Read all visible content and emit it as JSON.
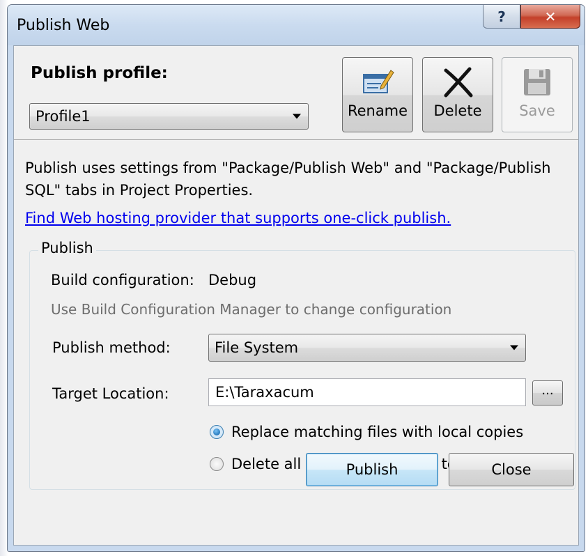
{
  "window": {
    "title": "Publish Web",
    "help_glyph": "?",
    "close_glyph": "✕"
  },
  "header": {
    "profile_label": "Publish profile:",
    "profile_value": "Profile1",
    "rename_label": "Rename",
    "delete_label": "Delete",
    "save_label": "Save",
    "save_enabled": false
  },
  "body": {
    "description": "Publish uses settings from \"Package/Publish Web\" and \"Package/Publish SQL\" tabs in Project Properties.",
    "provider_link": "Find Web hosting provider that supports one-click publish."
  },
  "publish_group": {
    "legend": "Publish",
    "build_config_label": "Build configuration:",
    "build_config_value": "Debug",
    "build_config_hint": "Use Build Configuration Manager to change configuration",
    "method_label": "Publish method:",
    "method_value": "File System",
    "target_label": "Target Location:",
    "target_value": "E:\\Taraxacum",
    "browse_label": "...",
    "radio_replace": {
      "label": "Replace matching files with local copies",
      "checked": true
    },
    "radio_delete": {
      "label": "Delete all existing files prior to publish",
      "checked": false
    }
  },
  "footer": {
    "publish_label": "Publish",
    "close_label": "Close"
  },
  "colors": {
    "link": "#0000ee",
    "accent": "#3c7fb1",
    "title_bar": "#cadbef",
    "close_button": "#c4402a"
  }
}
